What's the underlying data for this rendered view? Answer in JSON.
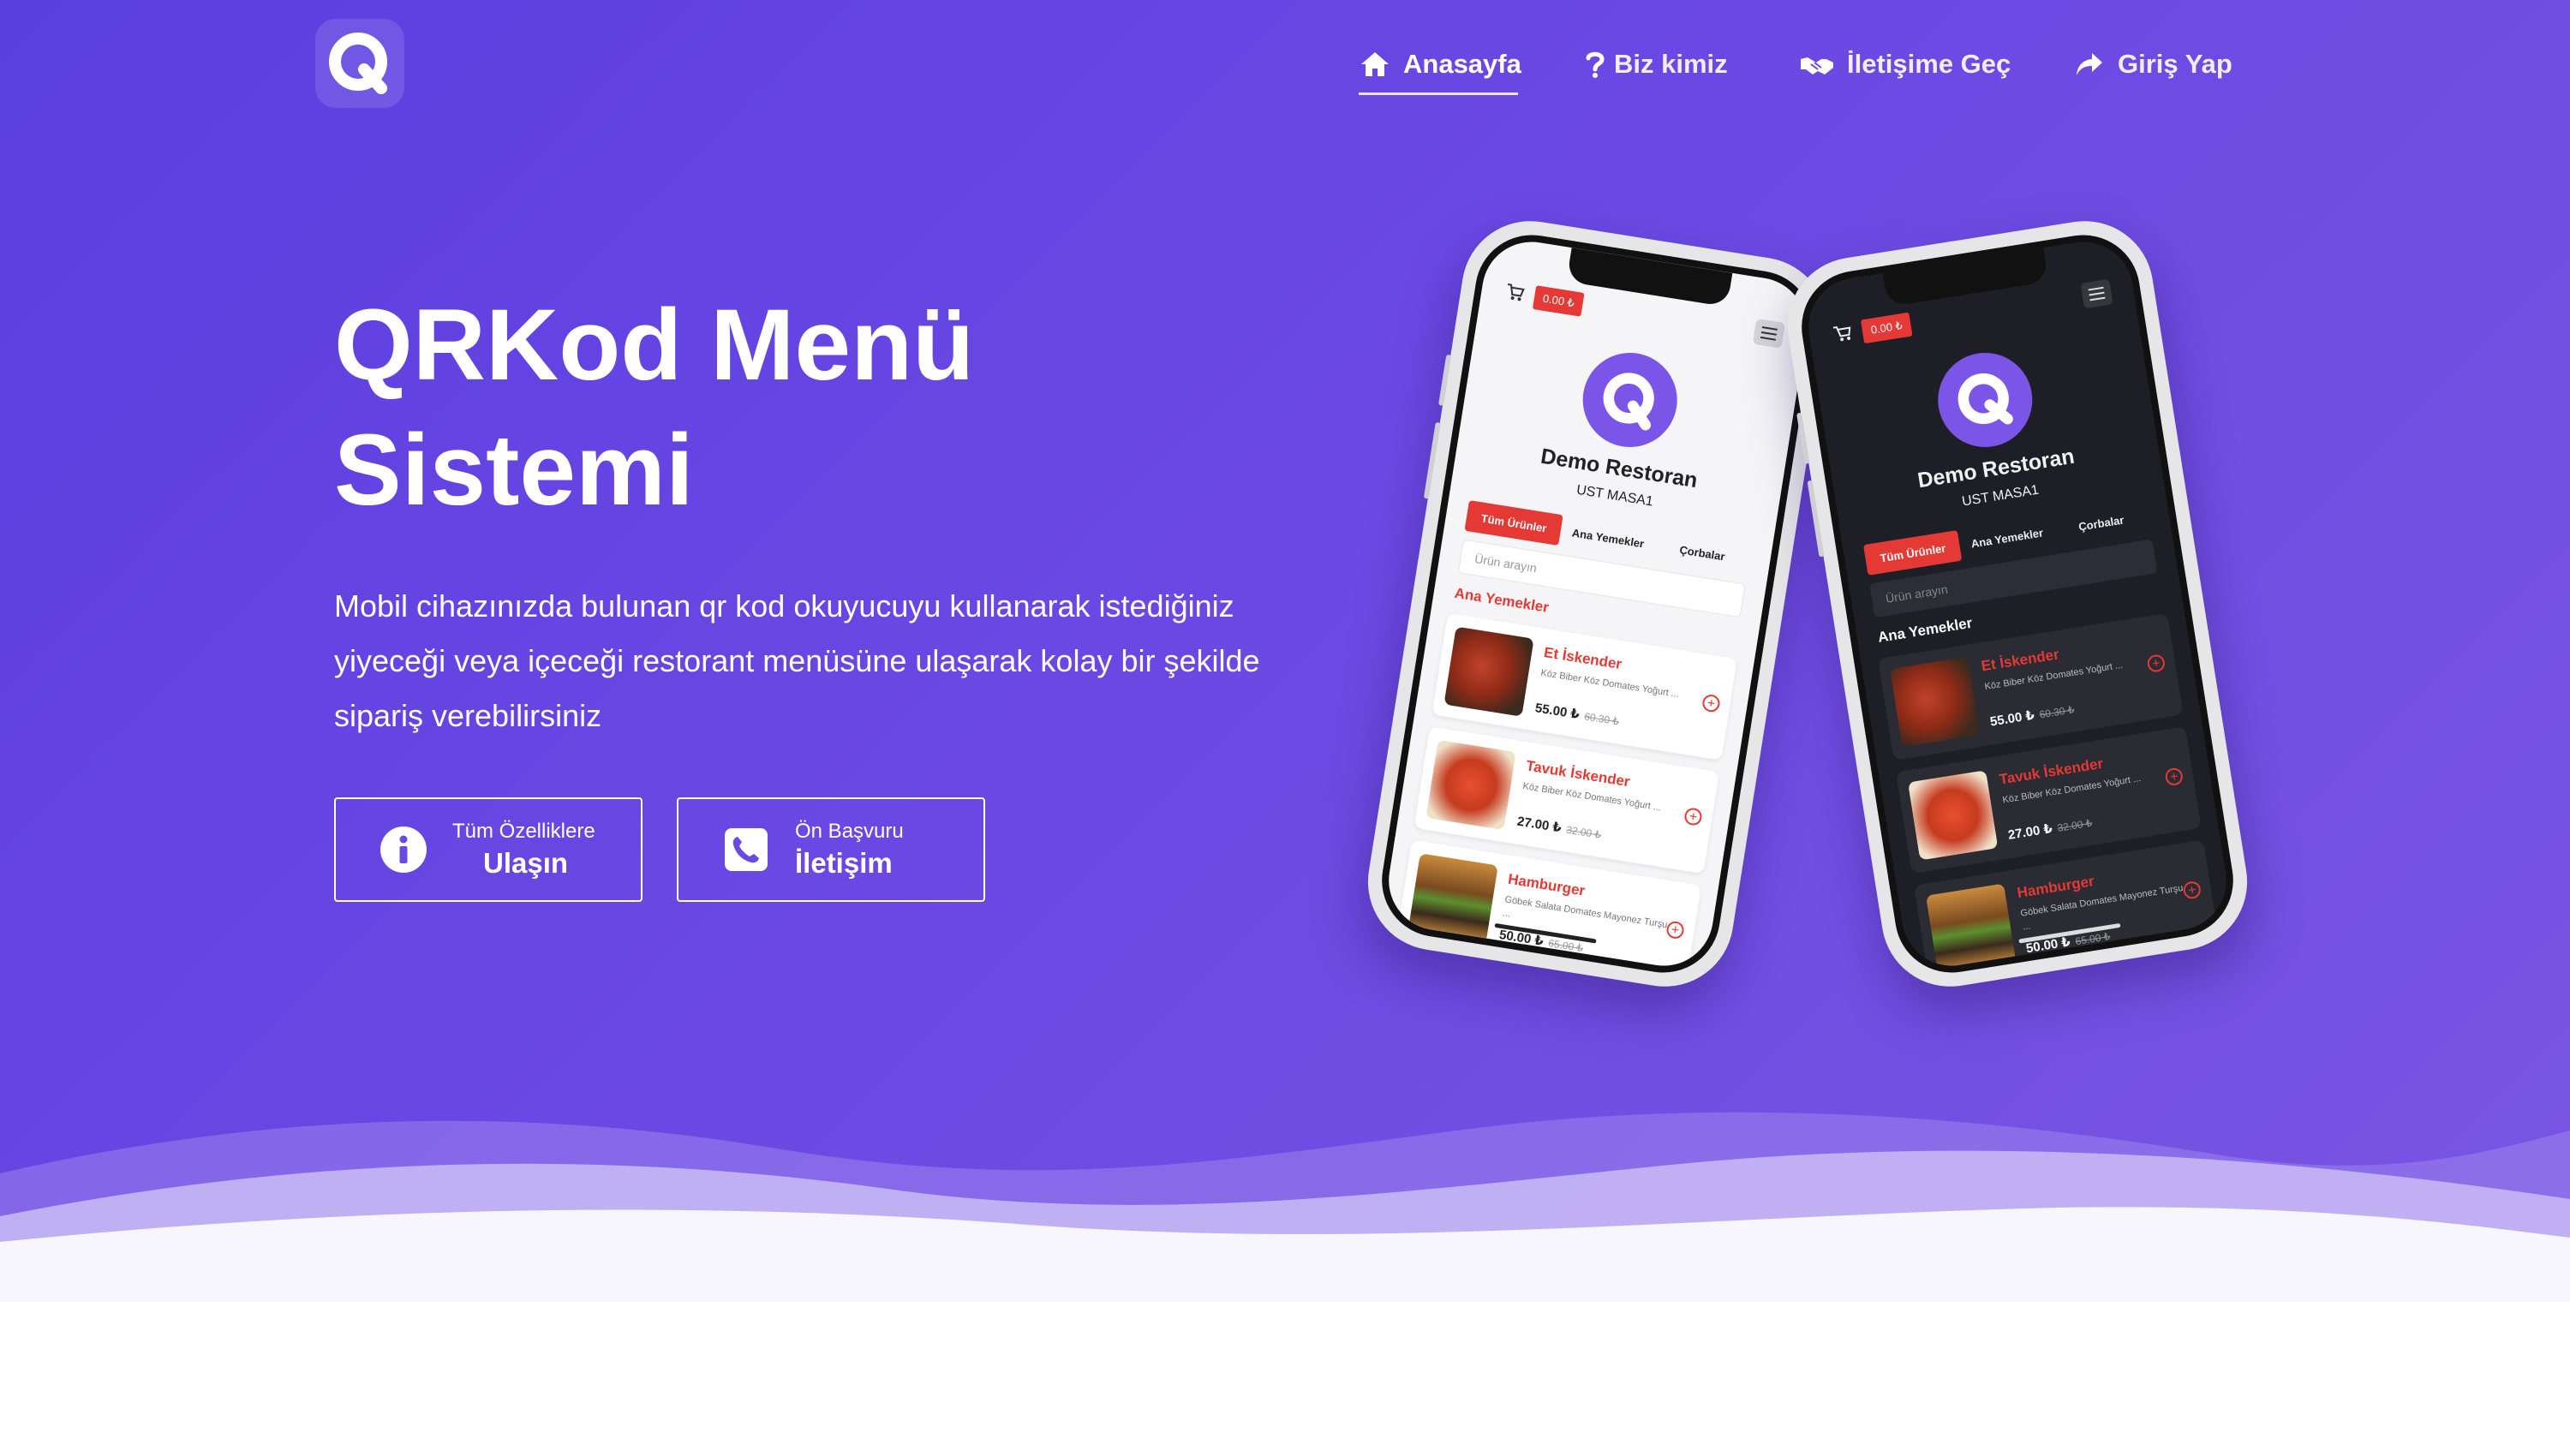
{
  "nav": {
    "items": [
      {
        "label": "Anasayfa",
        "icon": "home-icon",
        "active": true
      },
      {
        "label": "Biz kimiz",
        "icon": "question-icon",
        "active": false
      },
      {
        "label": "İletişime Geç",
        "icon": "handshake-icon",
        "active": false
      },
      {
        "label": "Giriş Yap",
        "icon": "share-arrow-icon",
        "active": false
      }
    ]
  },
  "hero": {
    "title_line1": "QRKod Menü",
    "title_line2": "Sistemi",
    "lead_line1": "Mobil cihazınızda bulunan qr kod okuyucuyu kullanarak istediğiniz",
    "lead_line2": "yiyeceği veya içeceği restorant menüsüne ulaşarak kolay bir şekilde",
    "lead_line3": "sipariş verebilirsiniz"
  },
  "cta": {
    "features": {
      "small": "Tüm Özelliklere",
      "big": "Ulaşın",
      "icon": "info-icon"
    },
    "contact": {
      "small": "Ön Başvuru",
      "big": "İletişim",
      "icon": "phone-icon"
    }
  },
  "mockup": {
    "cart_total": "0.00 ₺",
    "restaurant": "Demo Restoran",
    "table": "UST MASA1",
    "tabs": [
      "Tüm Ürünler",
      "Ana Yemekler",
      "Çorbalar"
    ],
    "search_placeholder": "Ürün arayın",
    "category": "Ana Yemekler",
    "products": [
      {
        "name": "Et İskender",
        "desc": "Köz Biber Köz Domates Yoğurt ...",
        "price": "55.00 ₺",
        "old_price": "60.30 ₺"
      },
      {
        "name": "Tavuk İskender",
        "desc": "Köz Biber Köz Domates Yoğurt ...",
        "price": "27.00 ₺",
        "old_price": "32.00 ₺"
      },
      {
        "name": "Hamburger",
        "desc": "Göbek Salata Domates Mayonez Turşu ...",
        "price": "50.00 ₺",
        "old_price": "65.00 ₺"
      }
    ]
  },
  "colors": {
    "hero_start": "#5a3fe0",
    "hero_end": "#7a55e2",
    "accent_red": "#e53935",
    "logo_purple": "#7b54e8"
  }
}
